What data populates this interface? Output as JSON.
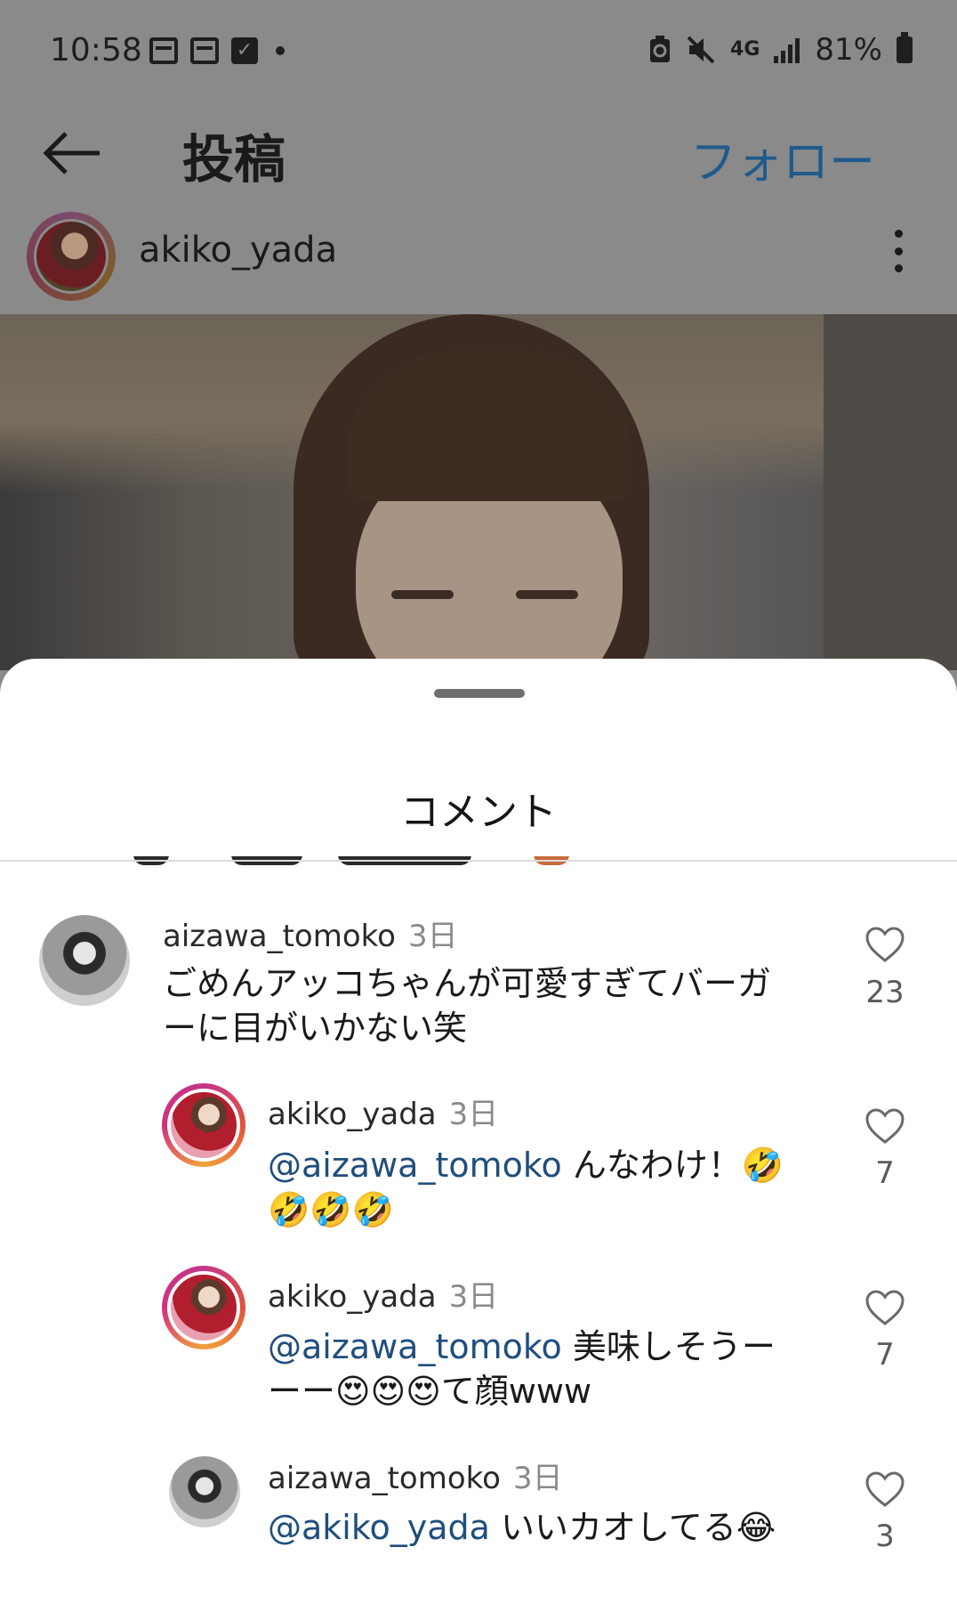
{
  "status_bar": {
    "time": "10:58",
    "network": "4G",
    "battery": "81%",
    "icons_left": [
      "calendar-icon",
      "calendar-icon",
      "checkbox-icon",
      "notification-dot"
    ],
    "icons_right": [
      "battery-saver-icon",
      "mute-icon",
      "4g-icon",
      "signal-icon",
      "battery-icon"
    ]
  },
  "header": {
    "title": "投稿",
    "follow_label": "フォロー"
  },
  "post_author": {
    "username": "akiko_yada"
  },
  "comments_sheet": {
    "title": "コメント",
    "comments": [
      {
        "username": "aizawa_tomoko",
        "time": "3日",
        "line1": "ごめんアッコちゃんが可愛すぎてバーガ",
        "line2": "ーに目がいかない笑",
        "likes": "23"
      },
      {
        "username": "akiko_yada",
        "time": "3日",
        "mention": "@aizawa_tomoko",
        "line1": " んなわけ！🤣",
        "line2": "🤣🤣🤣",
        "likes": "7"
      },
      {
        "username": "akiko_yada",
        "time": "3日",
        "mention": "@aizawa_tomoko",
        "line1": " 美味しそうー",
        "line2": "ーー😍😍😍て顔www",
        "likes": "7"
      },
      {
        "username": "aizawa_tomoko",
        "time": "3日",
        "mention": "@akiko_yada",
        "line1": " いいカオしてる😂",
        "likes": "3"
      }
    ]
  },
  "colors": {
    "dim_overlay": "#8a8a8a",
    "follow_blue": "#1f5a8c",
    "mention_blue": "#1f4e7d",
    "story_ring": "#c1358b"
  }
}
